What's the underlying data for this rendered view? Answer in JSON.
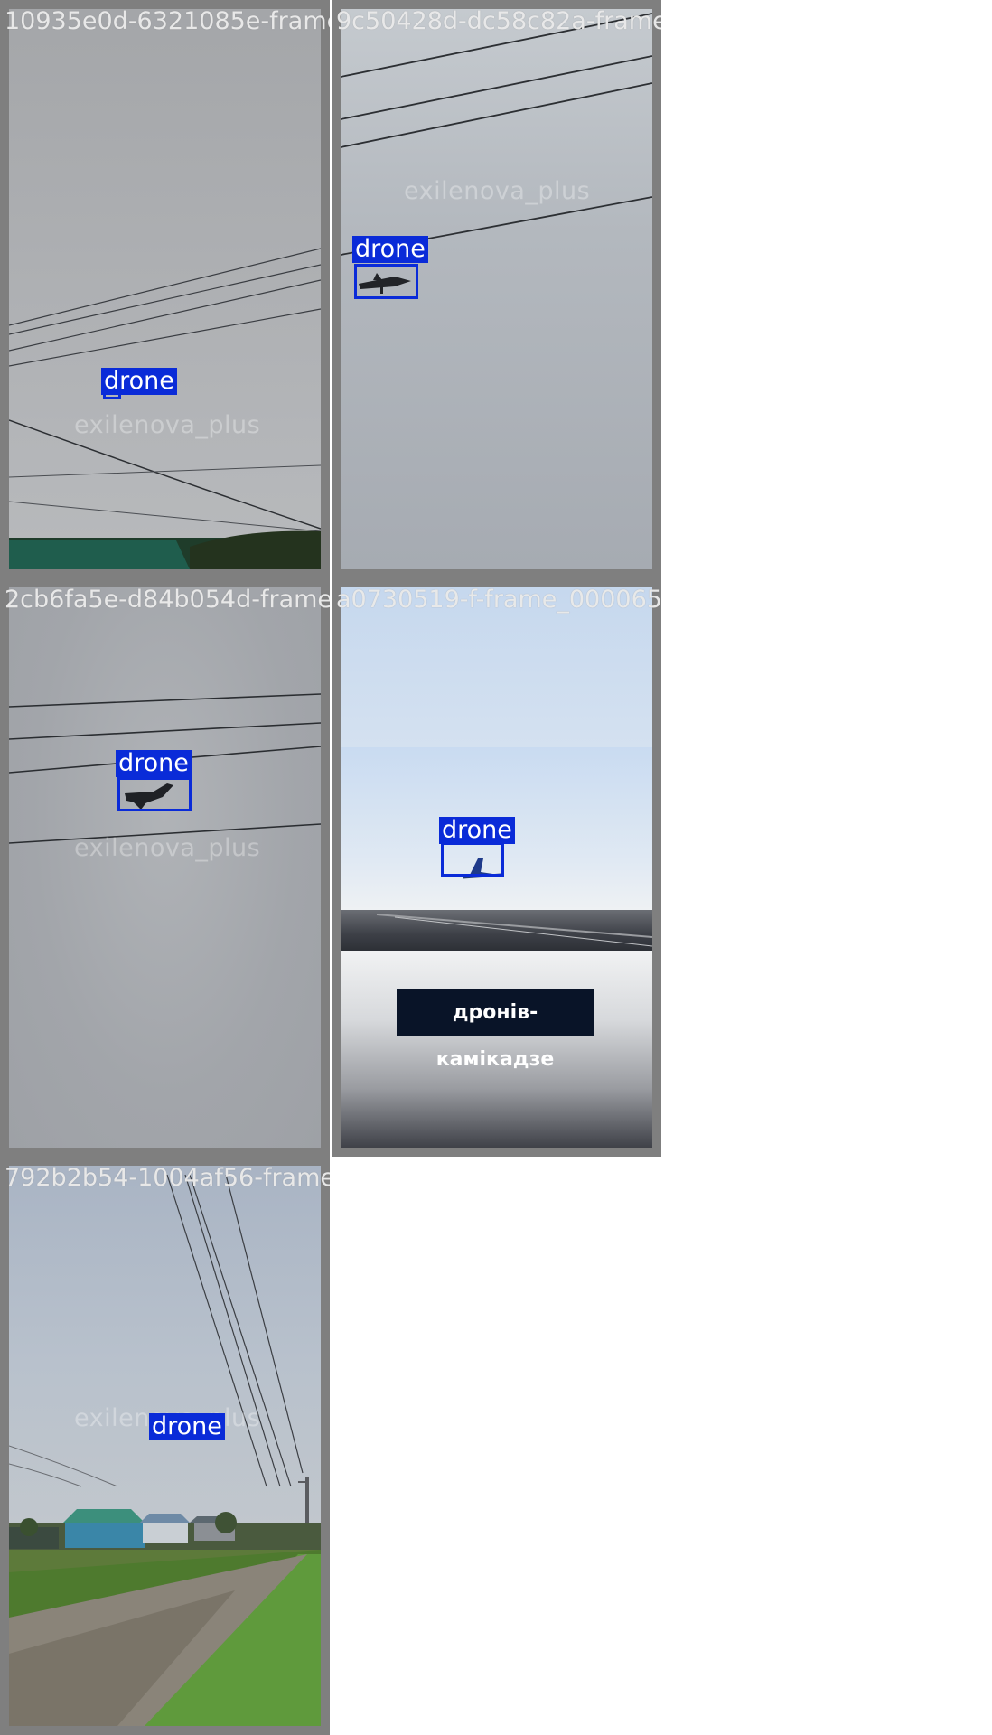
{
  "tiles": [
    {
      "filename": "10935e0d-6321085e-frame_000126.jpg",
      "watermark": "exilenova_plus",
      "detection_label": "drone"
    },
    {
      "filename": "9c50428d-dc58c82a-frame_000235.jpg",
      "watermark": "exilenova_plus",
      "detection_label": "drone"
    },
    {
      "filename": "2cb6fa5e-d84b054d-frame_000306.jpg",
      "watermark": "exilenova_plus",
      "detection_label": "drone"
    },
    {
      "filename": "a0730519-f-frame_000065.jpg",
      "detection_label": "drone",
      "banner_text": "дронів-камікадзе"
    },
    {
      "filename": "792b2b54-1004af56-frame_000456.jpg",
      "watermark": "exilenova_plus",
      "detection_label": "drone"
    }
  ],
  "colors": {
    "box": "#0a2bd8",
    "tile_border": "#7f7f7f",
    "background": "#ffffff"
  }
}
